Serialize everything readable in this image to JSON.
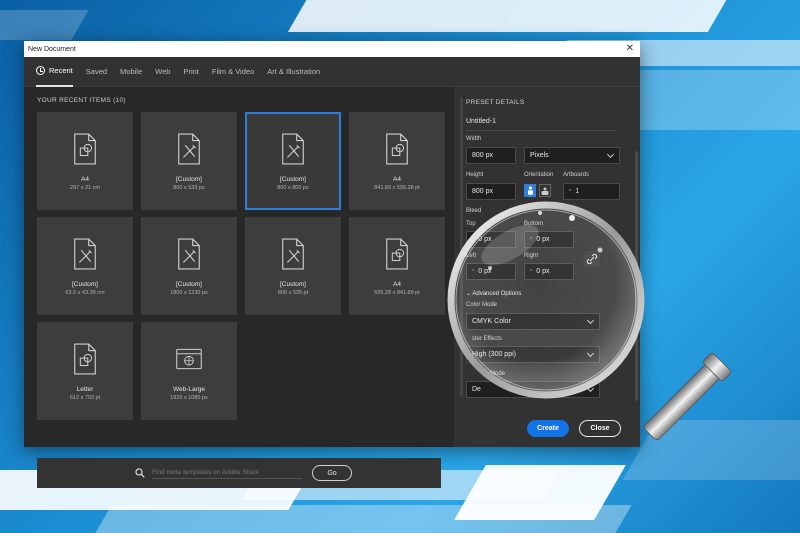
{
  "window": {
    "title": "New Document",
    "close_glyph": "✕"
  },
  "tabs": [
    {
      "label": "Recent",
      "icon": "clock-icon",
      "active": true
    },
    {
      "label": "Saved"
    },
    {
      "label": "Mobile"
    },
    {
      "label": "Web"
    },
    {
      "label": "Print"
    },
    {
      "label": "Film & Video"
    },
    {
      "label": "Art & Illustration"
    }
  ],
  "recent": {
    "heading": "YOUR RECENT ITEMS",
    "count": "(10)",
    "items": [
      {
        "name": "A4",
        "size": "297 x 21 cm",
        "icon": "print-document-icon"
      },
      {
        "name": "[Custom]",
        "size": "800 x 533 px",
        "icon": "custom-document-icon"
      },
      {
        "name": "[Custom]",
        "size": "800 x 800 px",
        "icon": "custom-document-icon",
        "selected": true
      },
      {
        "name": "A4",
        "size": "841.89 x 595.28 pt",
        "icon": "print-document-icon"
      },
      {
        "name": "[Custom]",
        "size": "63.5 x 43.39 cm",
        "icon": "custom-document-icon"
      },
      {
        "name": "[Custom]",
        "size": "1800 x 1230 px",
        "icon": "custom-document-icon"
      },
      {
        "name": "[Custom]",
        "size": "800 x 535 pt",
        "icon": "custom-document-icon"
      },
      {
        "name": "A4",
        "size": "595.28 x 841.89 pt",
        "icon": "print-document-icon"
      },
      {
        "name": "Letter",
        "size": "612 x 792 pt",
        "icon": "print-document-icon"
      },
      {
        "name": "Web-Large",
        "size": "1920 x 1080 px",
        "icon": "web-document-icon"
      }
    ]
  },
  "search": {
    "placeholder": "Find more templates on Adobe Stock",
    "go_label": "Go"
  },
  "preset": {
    "heading": "PRESET DETAILS",
    "name": "Untitled-1",
    "width_label": "Width",
    "width_value": "800 px",
    "units": "Pixels",
    "height_label": "Height",
    "height_value": "800 px",
    "orientation_label": "Orientation",
    "artboards_label": "Artboards",
    "artboards_value": "1",
    "bleed_label": "Bleed",
    "top_label": "Top",
    "top_value": "0 px",
    "bottom_label": "Bottom",
    "bottom_value": "0 px",
    "left_label": "Left",
    "left_value": "0 px",
    "right_label": "Right",
    "right_value": "0 px",
    "advanced_label": "Advanced Options",
    "color_mode_label": "Color Mode",
    "color_mode_value": "CMYK Color",
    "raster_label": "ster Effects",
    "raster_value": "High (300 ppi)",
    "preview_label": "Mode",
    "preview_value": "De"
  },
  "actions": {
    "create_label": "Create",
    "close_label": "Close"
  },
  "colors": {
    "accent": "#1473e6",
    "selection": "#2e7fd9",
    "panel": "#282828"
  }
}
